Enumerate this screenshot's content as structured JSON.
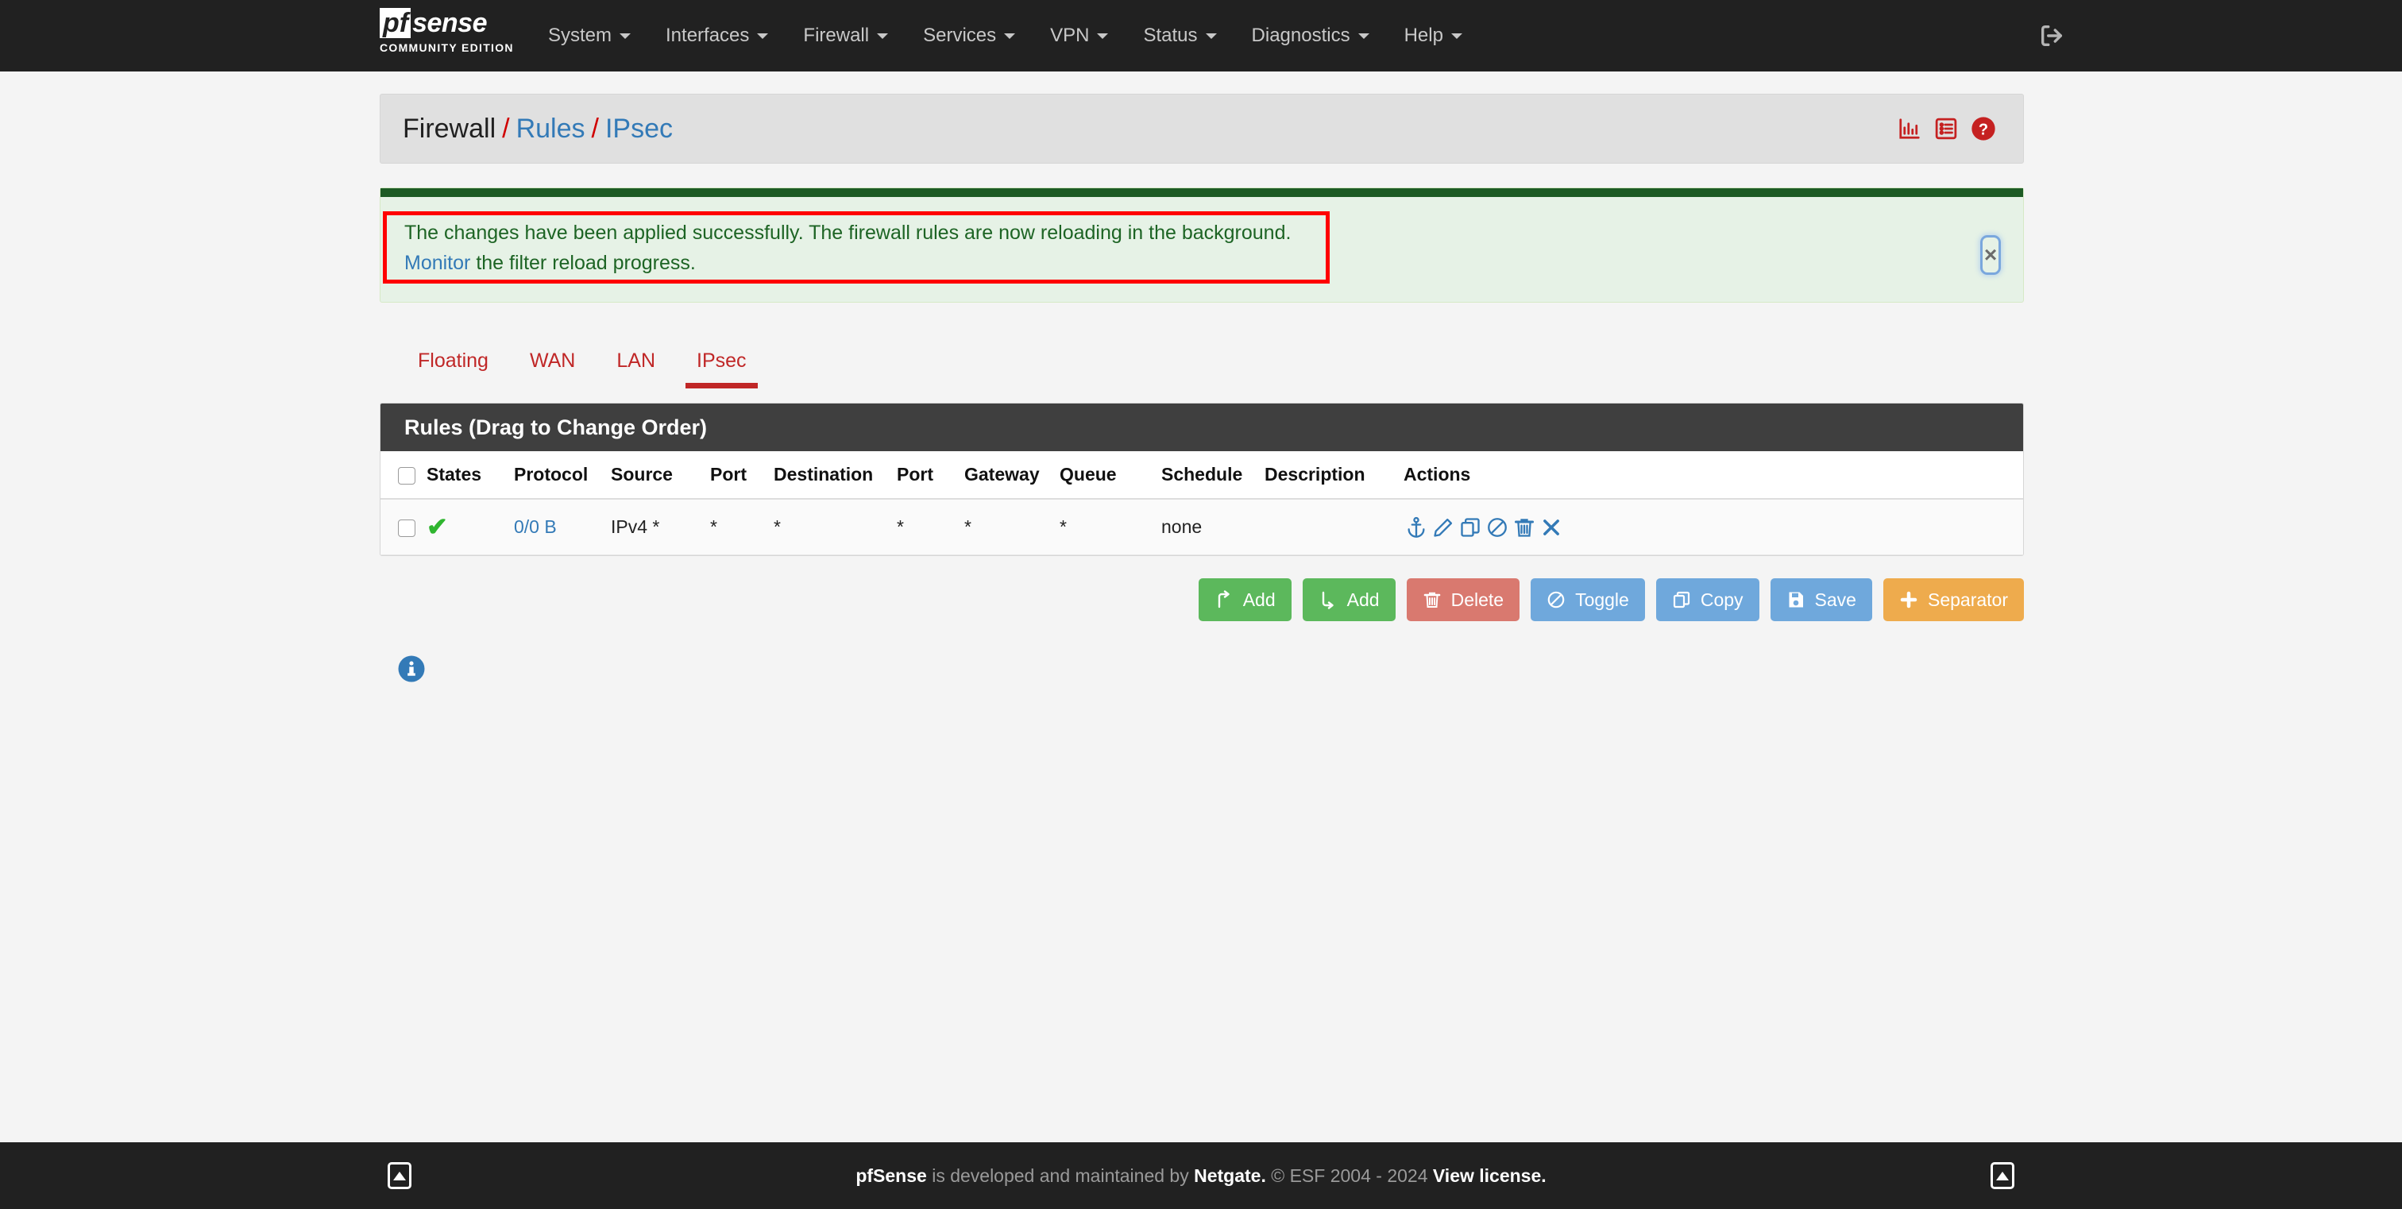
{
  "navbar": {
    "brand_pf": "pf",
    "brand_sense": "sense",
    "brand_subtitle": "COMMUNITY EDITION",
    "items": [
      {
        "label": "System"
      },
      {
        "label": "Interfaces"
      },
      {
        "label": "Firewall"
      },
      {
        "label": "Services"
      },
      {
        "label": "VPN"
      },
      {
        "label": "Status"
      },
      {
        "label": "Diagnostics"
      },
      {
        "label": "Help"
      }
    ],
    "logout_icon": "logout-icon"
  },
  "breadcrumb": {
    "root": "Firewall",
    "sep1": "/",
    "level2": "Rules",
    "sep2": "/",
    "level3": "IPsec",
    "icons": [
      "chart-icon",
      "list-icon",
      "help-icon"
    ]
  },
  "alert": {
    "message": "The changes have been applied successfully. The firewall rules are now reloading in the background.",
    "link_text": "Monitor",
    "after_link": " the filter reload progress.",
    "close_label": "×",
    "top_bar_color": "#1d5b24",
    "background_color": "#e6f2e6",
    "text_color": "#1d6424",
    "highlight_color": "#ff0000"
  },
  "tabs": [
    {
      "label": "Floating",
      "active": false
    },
    {
      "label": "WAN",
      "active": false
    },
    {
      "label": "LAN",
      "active": false
    },
    {
      "label": "IPsec",
      "active": true
    }
  ],
  "rules_panel": {
    "title": "Rules (Drag to Change Order)",
    "columns": [
      "",
      "States",
      "Protocol",
      "Source",
      "Port",
      "Destination",
      "Port",
      "Gateway",
      "Queue",
      "Schedule",
      "Description",
      "Actions"
    ],
    "rows": [
      {
        "status_icon": "check-icon",
        "states": "0/0 B",
        "protocol": "IPv4 *",
        "source": "*",
        "port_src": "*",
        "destination": "*",
        "port_dst": "*",
        "gateway": "*",
        "queue": "none",
        "schedule": "",
        "description": "",
        "actions": [
          "anchor-icon",
          "edit-icon",
          "copy-icon",
          "block-icon",
          "delete-icon",
          "remove-icon"
        ]
      }
    ]
  },
  "buttons": [
    {
      "label": "Add",
      "icon": "arrow-up-icon",
      "style": "green"
    },
    {
      "label": "Add",
      "icon": "arrow-down-icon",
      "style": "green"
    },
    {
      "label": "Delete",
      "icon": "trash-icon",
      "style": "red"
    },
    {
      "label": "Toggle",
      "icon": "ban-icon",
      "style": "blue"
    },
    {
      "label": "Copy",
      "icon": "copy-icon",
      "style": "blue"
    },
    {
      "label": "Save",
      "icon": "save-icon",
      "style": "blue"
    },
    {
      "label": "Separator",
      "icon": "plus-icon",
      "style": "orange"
    }
  ],
  "info": {
    "icon": "info-icon"
  },
  "footer": {
    "brand": "pfSense",
    "mid": " is developed and maintained by ",
    "company": "Netgate.",
    "copyright": " © ESF 2004 - 2024 ",
    "license": "View license."
  }
}
